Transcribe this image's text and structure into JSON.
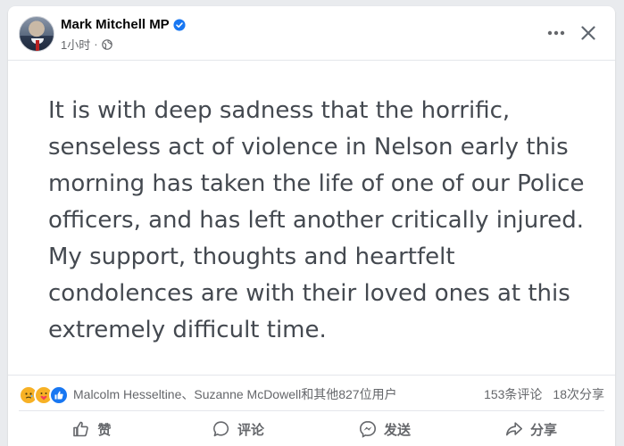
{
  "post": {
    "author": "Mark Mitchell MP",
    "time": "1小时",
    "separator": "·",
    "text": "It is with deep sadness that the horrific, senseless act of violence in Nelson early this morning has taken the life of one of our Police officers, and has left another critically injured. My support, thoughts and heartfelt condolences are with their loved ones at this extremely difficult time."
  },
  "stats": {
    "reactors": "Malcolm Hesseltine、Suzanne McDowell和其他827位用户",
    "comments": "153条评论",
    "shares": "18次分享"
  },
  "actions": {
    "like": "赞",
    "comment": "评论",
    "send": "发送",
    "share": "分享"
  },
  "icons": {
    "verified": "verified-badge-icon",
    "privacy": "globe-icon",
    "more": "more-horizontal-icon",
    "close": "close-icon"
  },
  "colors": {
    "accent": "#1877f2",
    "text_secondary": "#65676b",
    "post_text": "#444950"
  }
}
